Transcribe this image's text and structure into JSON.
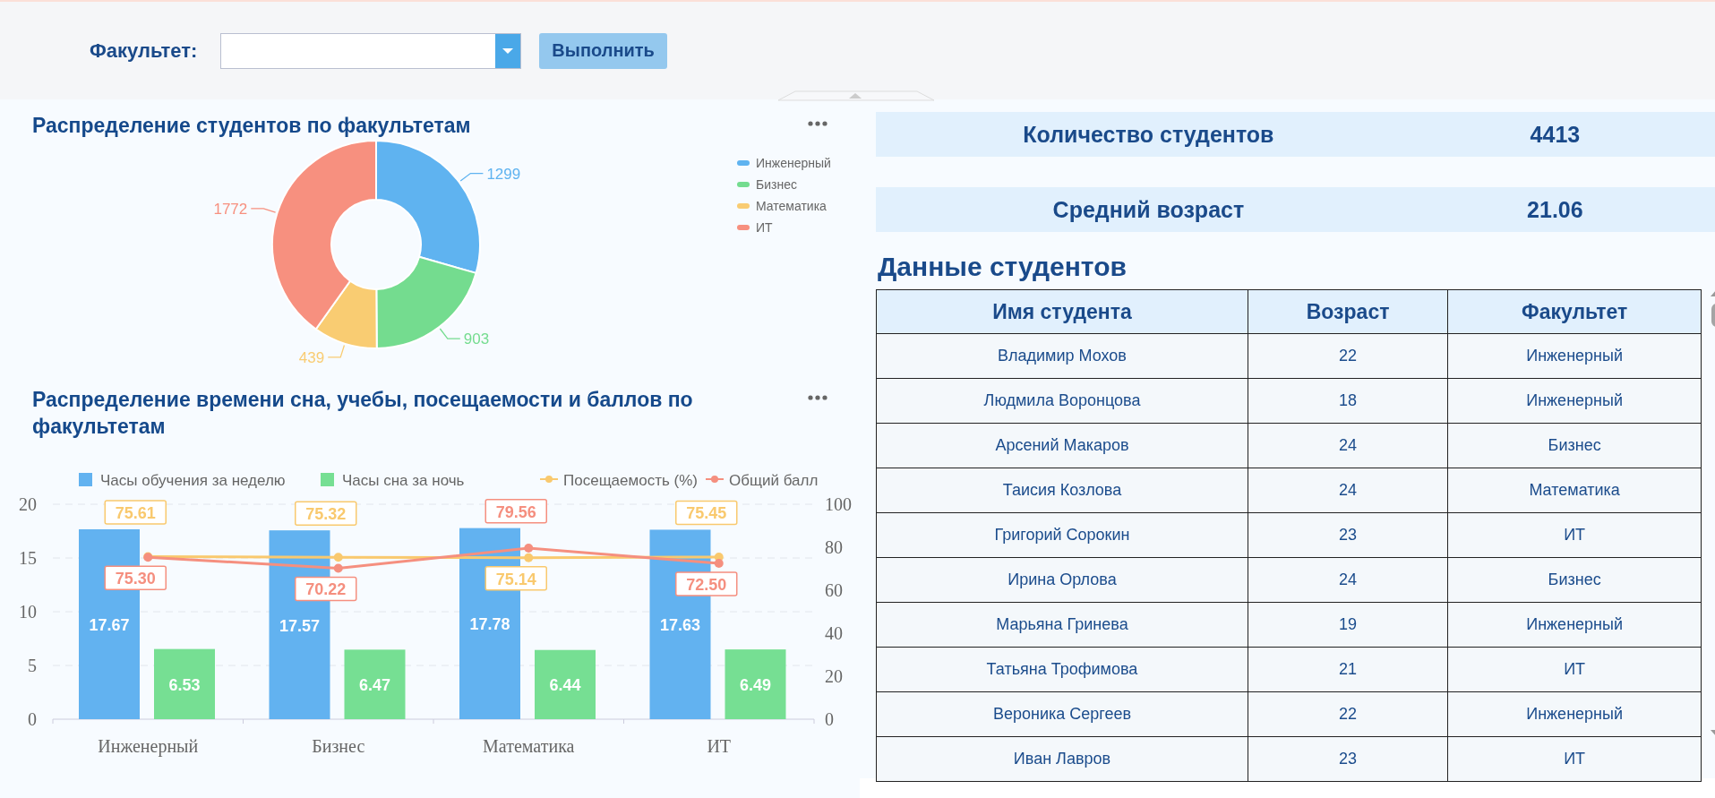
{
  "filter": {
    "label": "Факультет:",
    "run_button": "Выполнить"
  },
  "faculty_chart": {
    "title": "Распределение студентов по факультетам",
    "chart_data": {
      "type": "donut",
      "categories": [
        "Инженерный",
        "Бизнес",
        "Математика",
        "ИТ"
      ],
      "values": [
        1299,
        903,
        439,
        1772
      ],
      "colors": [
        "#5fb3f0",
        "#74dc8f",
        "#f9cc72",
        "#f7907f"
      ],
      "legend": "right",
      "data_labels": true
    }
  },
  "metrics_chart": {
    "title": "Распределение времени сна, учебы, посещаемости и баллов по факультетам",
    "bar_layer": {
      "chart_data": {
        "type": "bar",
        "categories": [
          "Инженерный",
          "Бизнес",
          "Математика",
          "ИТ"
        ],
        "yticks": [
          0,
          5,
          10,
          15,
          20
        ],
        "ylim": [
          0,
          20
        ],
        "grid": true,
        "legend": "top",
        "data_labels": true,
        "series": [
          {
            "name": "Часы обучения за неделю",
            "color": "#62b2f0",
            "values": [
              17.67,
              17.57,
              17.78,
              17.63
            ]
          },
          {
            "name": "Часы сна за ночь",
            "color": "#76df93",
            "values": [
              6.53,
              6.47,
              6.44,
              6.49
            ]
          }
        ]
      }
    },
    "line_layer": {
      "chart_data": {
        "type": "line",
        "yticks": [
          0,
          20,
          40,
          60,
          80,
          100
        ],
        "ylim": [
          0,
          100
        ],
        "legend": "top",
        "series": [
          {
            "name": "Посещаемость (%)",
            "color": "#f9c96e",
            "marker": "circle",
            "values": [
              75.61,
              75.32,
              75.14,
              75.45
            ],
            "value_labels": [
              "75.61",
              "75.32",
              "75.14",
              "75.45"
            ]
          },
          {
            "name": "Общий балл",
            "color": "#f58f7f",
            "marker": "circle",
            "values": [
              75.3,
              70.22,
              79.56,
              72.5
            ],
            "value_labels": [
              "75.30",
              "70.22",
              "79.56",
              "72.50"
            ]
          }
        ]
      }
    }
  },
  "stats": [
    {
      "label": "Количество студентов",
      "value": "4413"
    },
    {
      "label": "Средний возраст",
      "value": "21.06"
    }
  ],
  "students_table": {
    "title": "Данные студентов",
    "columns": [
      "Имя студента",
      "Возраст",
      "Факультет"
    ],
    "rows": [
      [
        "Владимир Мохов",
        "22",
        "Инженерный"
      ],
      [
        "Людмила Воронцова",
        "18",
        "Инженерный"
      ],
      [
        "Арсений Макаров",
        "24",
        "Бизнес"
      ],
      [
        "Таисия Козлова",
        "24",
        "Математика"
      ],
      [
        "Григорий Сорокин",
        "23",
        "ИТ"
      ],
      [
        "Ирина Орлова",
        "24",
        "Бизнес"
      ],
      [
        "Марьяна Гринева",
        "19",
        "Инженерный"
      ],
      [
        "Татьяна Трофимова",
        "21",
        "ИТ"
      ],
      [
        "Вероника Сергеев",
        "22",
        "Инженерный"
      ],
      [
        "Иван Лавров",
        "23",
        "ИТ"
      ]
    ]
  }
}
